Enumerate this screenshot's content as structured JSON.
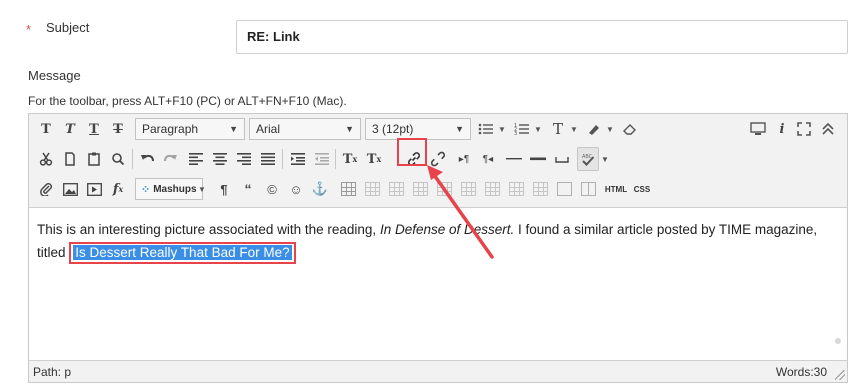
{
  "subject": {
    "required_mark": "*",
    "label": "Subject",
    "value": "RE: Link"
  },
  "message": {
    "label": "Message",
    "toolbar_hint": "For the toolbar, press ALT+F10 (PC) or ALT+FN+F10 (Mac)."
  },
  "toolbar": {
    "format_select": "Paragraph",
    "font_select": "Arial",
    "size_select": "3 (12pt)",
    "mashups_label": "Mashups",
    "html_label": "HTML",
    "css_label": "CSS"
  },
  "content": {
    "part1": "This is an interesting picture associated with the reading, ",
    "title_italic": "In Defense of Dessert.",
    "part2": "  I found a similar article posted by TIME magazine, titled ",
    "selected_text": "Is Dessert Really That Bad For Me?"
  },
  "status": {
    "path": "Path: p",
    "words": "Words:30"
  },
  "colors": {
    "highlight_border": "#e8434a",
    "selection_bg": "#3a8ee6",
    "required": "#d9534f"
  }
}
